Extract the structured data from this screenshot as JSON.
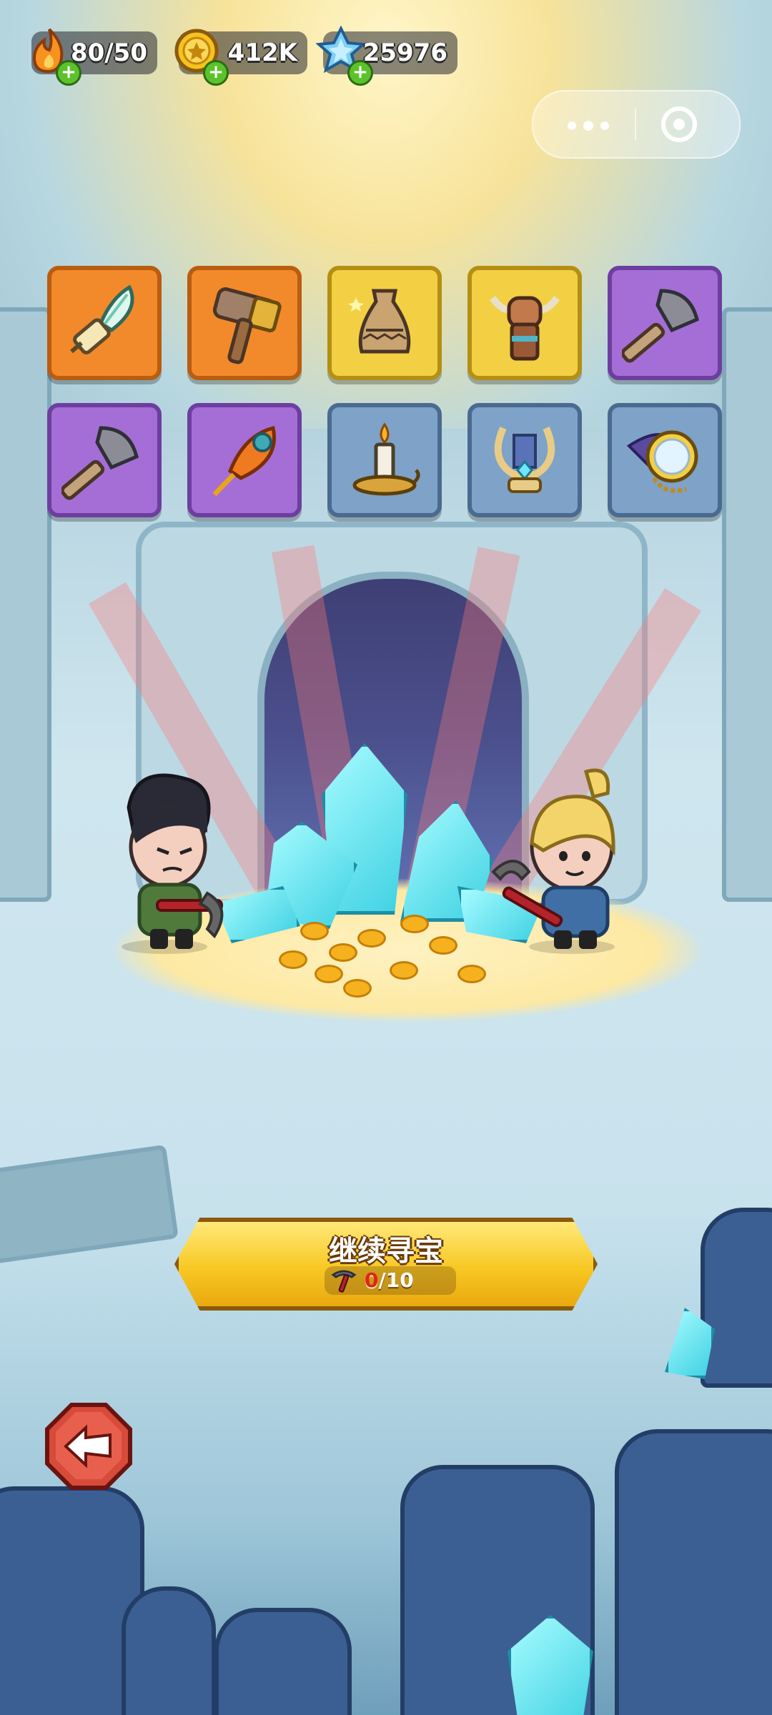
{
  "hud": {
    "energy": {
      "value": "80/50",
      "icon": "fire-icon"
    },
    "gold": {
      "value": "412K",
      "icon": "gold-coin-icon"
    },
    "crystal": {
      "value": "25976",
      "icon": "blue-crystal-icon"
    }
  },
  "capsule": {
    "more_icon": "more-dots-icon",
    "close_icon": "target-close-icon"
  },
  "items": [
    {
      "name": "feather-quill",
      "rarity": "orange"
    },
    {
      "name": "stone-hammer",
      "rarity": "orange"
    },
    {
      "name": "clay-vase",
      "rarity": "yellow"
    },
    {
      "name": "bull-totem",
      "rarity": "yellow"
    },
    {
      "name": "battle-axe",
      "rarity": "purple"
    },
    {
      "name": "battle-axe",
      "rarity": "purple"
    },
    {
      "name": "phoenix-feather",
      "rarity": "purple"
    },
    {
      "name": "candle",
      "rarity": "blue"
    },
    {
      "name": "golden-lyre",
      "rarity": "blue"
    },
    {
      "name": "pocket-mirror",
      "rarity": "blue"
    }
  ],
  "action": {
    "label": "继续寻宝",
    "progress_current": "0",
    "progress_total": "/10",
    "progress_icon": "pickaxe-icon"
  },
  "back": {
    "icon": "back-arrow-icon"
  },
  "colors": {
    "orange": "#f28a2b",
    "yellow": "#f3cf43",
    "purple": "#a56ed6",
    "blue": "#7ea2c8",
    "button": "#f8c823"
  }
}
